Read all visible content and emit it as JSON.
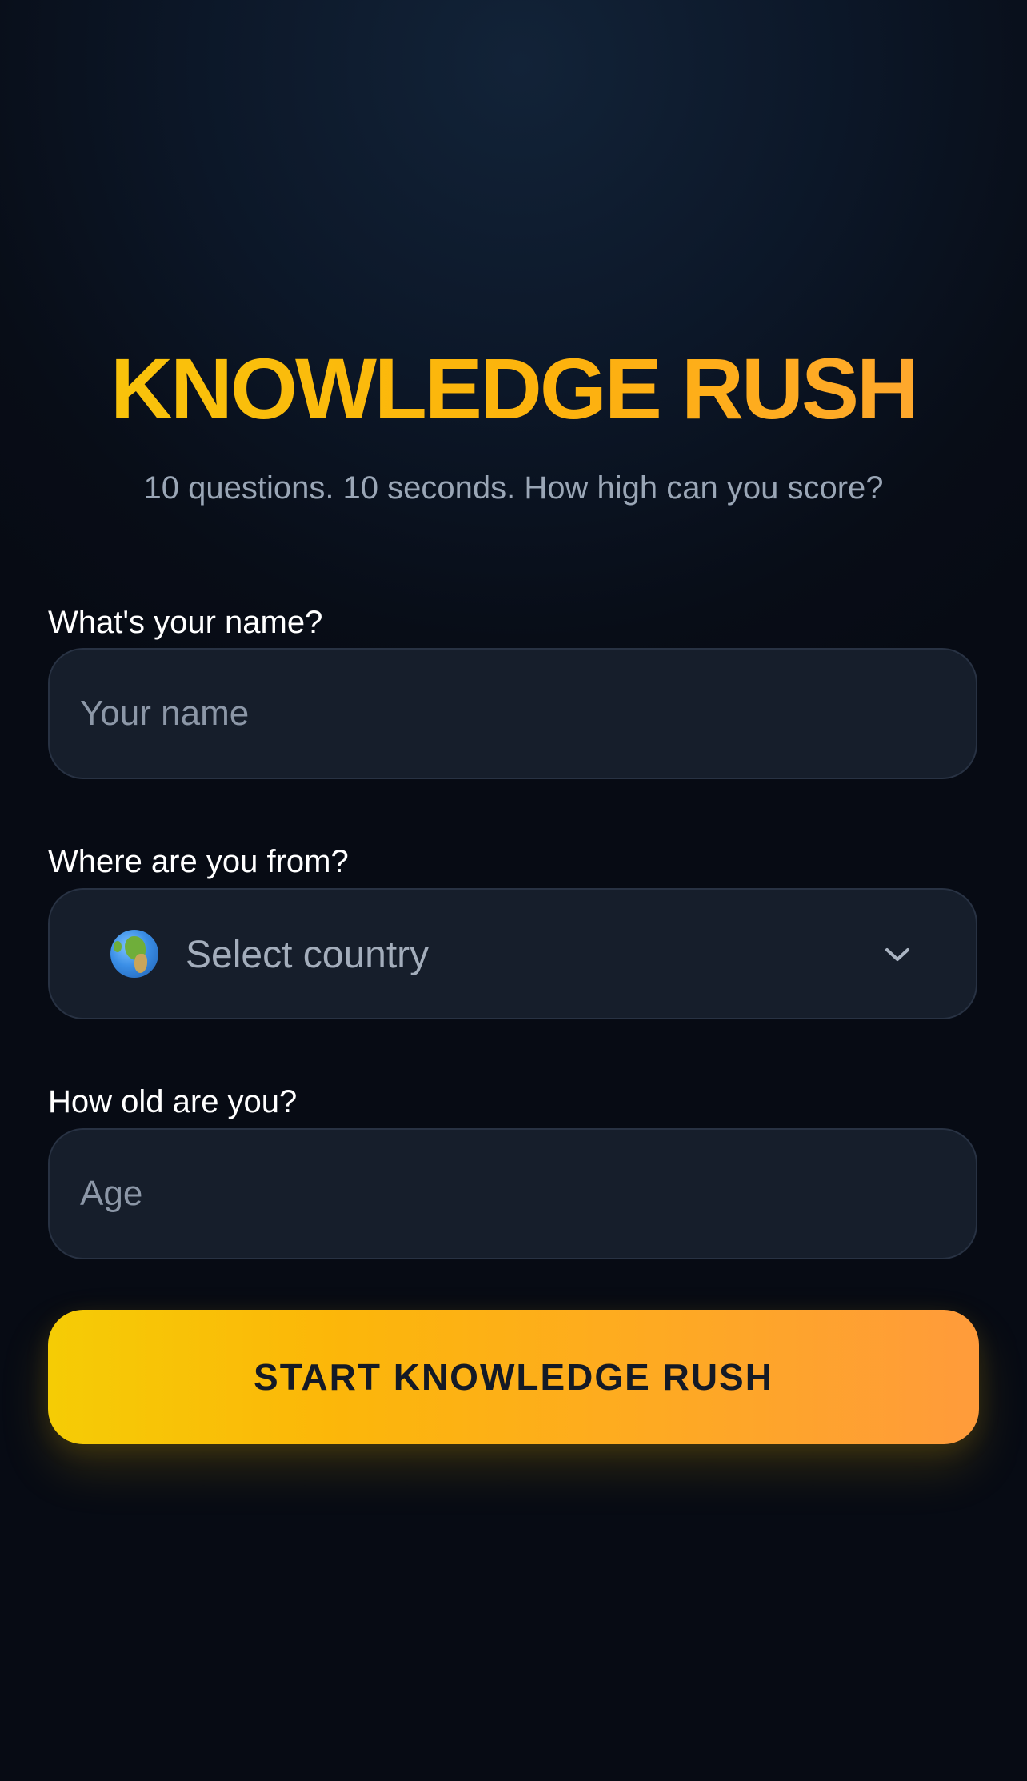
{
  "title": "KNOWLEDGE RUSH",
  "subtitle": "10 questions. 10 seconds. How high can you score?",
  "name_field": {
    "label": "What's your name?",
    "placeholder": "Your name",
    "value": ""
  },
  "country_field": {
    "label": "Where are you from?",
    "selected": "Select country",
    "icon": "globe-icon",
    "dropdown_icon": "chevron-down-icon"
  },
  "age_field": {
    "label": "How old are you?",
    "placeholder": "Age",
    "value": ""
  },
  "start_button": {
    "label": "START KNOWLEDGE RUSH"
  },
  "colors": {
    "background": "#070b14",
    "field_background": "#161e2b",
    "field_border": "#283243",
    "accent_start": "#f5cc05",
    "accent_end": "#ff9b3b",
    "button_text": "#141a26",
    "subtitle": "#9aa6b6"
  }
}
